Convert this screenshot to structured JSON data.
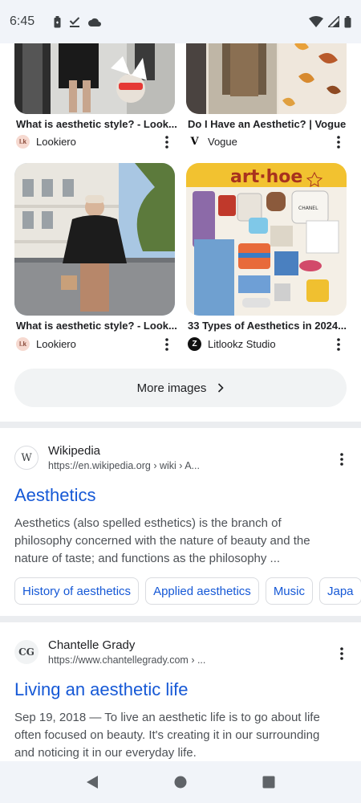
{
  "status_bar": {
    "time": "6:45"
  },
  "image_results": [
    {
      "caption": "What is aesthetic style? - Look...",
      "source": "Lookiero",
      "source_icon_text": "l.k"
    },
    {
      "caption": "Do I Have an Aesthetic? | Vogue",
      "source": "Vogue",
      "source_icon_text": "V"
    },
    {
      "caption": "What is aesthetic style? - Look...",
      "source": "Lookiero",
      "source_icon_text": "l.k"
    },
    {
      "caption": "33 Types of Aesthetics in 2024...",
      "source": "Litlookz Studio",
      "source_icon_text": "Z"
    }
  ],
  "image_overlay_text": {
    "art_hoe": "art·hoe",
    "chanel": "CHANEL"
  },
  "more_images": {
    "label": "More images"
  },
  "results": [
    {
      "site": "Wikipedia",
      "favicon_text": "W",
      "url": "https://en.wikipedia.org › wiki › A...",
      "title": "Aesthetics",
      "snippet": "Aesthetics (also spelled esthetics) is the branch of philosophy concerned with the nature of beauty and the nature of taste; and functions as the philosophy ...",
      "chips": [
        "History of aesthetics",
        "Applied aesthetics",
        "Music",
        "Japa"
      ]
    },
    {
      "site": "Chantelle Grady",
      "favicon_text": "CG",
      "url": "https://www.chantellegrady.com › ...",
      "title": "Living an aesthetic life",
      "snippet": "Sep 19, 2018 — To live an aesthetic life is to go about life often focused on beauty. It's creating it in our surrounding and noticing it in our everyday life."
    }
  ],
  "colors": {
    "link": "#1558d6",
    "status_bg": "#f1f4f9",
    "chip_border": "#dadce0"
  },
  "icons": {
    "status_left": [
      "battery-saver-icon",
      "download-done-icon",
      "cloud-icon"
    ],
    "status_right": [
      "wifi-icon",
      "signal-icon",
      "battery-icon"
    ],
    "nav": [
      "back-icon",
      "home-icon",
      "recents-icon"
    ]
  }
}
